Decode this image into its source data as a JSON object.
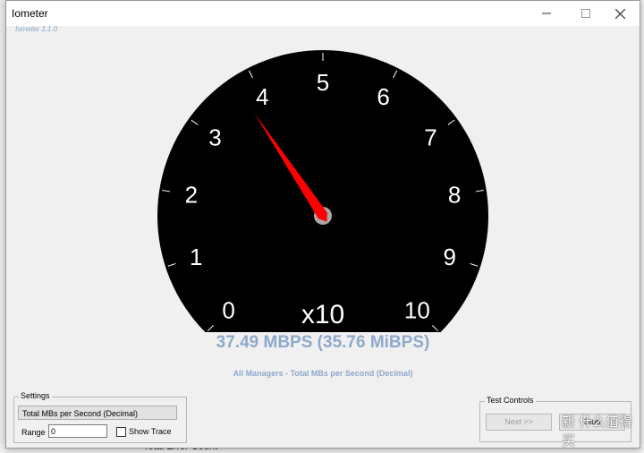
{
  "window": {
    "title": "Iometer",
    "version": "Iometer 1.1.0",
    "minimize_icon": "minimize-icon",
    "maximize_icon": "maximize-icon",
    "close_icon": "close-icon"
  },
  "gauge": {
    "scale_labels": [
      "0",
      "1",
      "2",
      "3",
      "4",
      "5",
      "6",
      "7",
      "8",
      "9",
      "10"
    ],
    "multiplier": "x10",
    "needle_value": 3.749,
    "min": 0,
    "max": 10,
    "face_color": "#000000",
    "needle_color": "#ff0000"
  },
  "readout": {
    "value_text": "37.49 MBPS (35.76 MiBPS)",
    "metric_label": "All Managers - Total MBs per Second (Decimal)"
  },
  "settings": {
    "legend": "Settings",
    "metric_selected": "Total MBs per Second (Decimal)",
    "range_label": "Range",
    "range_value": "0",
    "show_trace_label": "Show Trace",
    "show_trace_checked": false
  },
  "test_controls": {
    "legend": "Test Controls",
    "next_label": "Next >>",
    "stop_label": "Stop"
  },
  "background": {
    "partial_text": "Total Error Count"
  },
  "watermark": {
    "text": "新 什么值得买"
  }
}
